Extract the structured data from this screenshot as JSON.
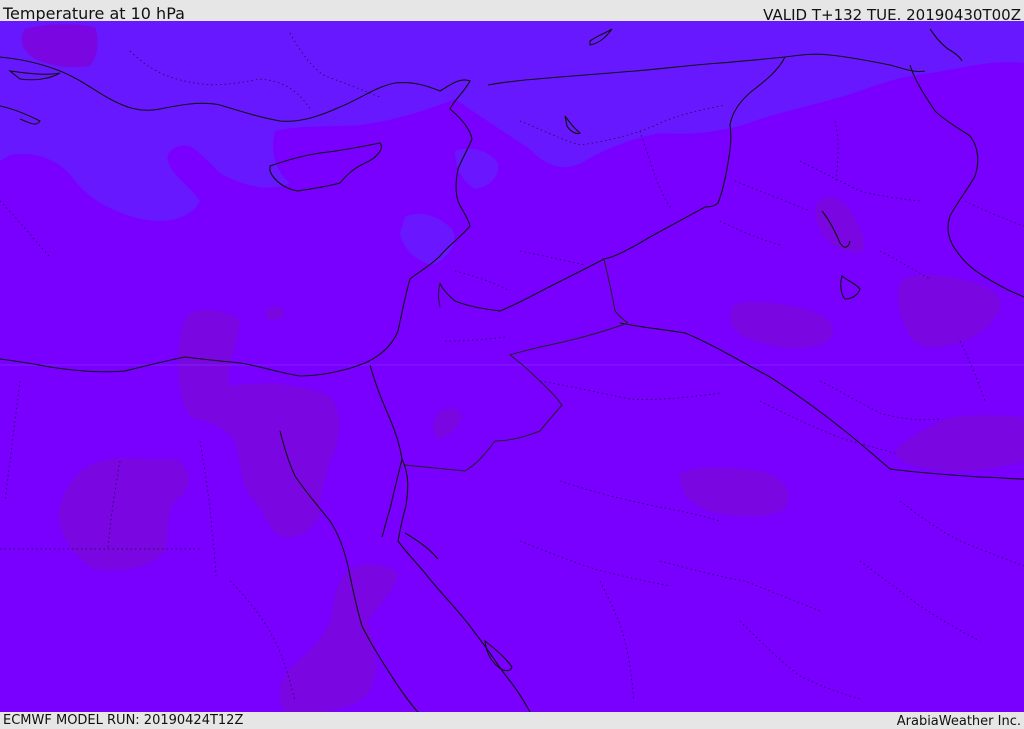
{
  "header": {
    "title": "Temperature at 10 hPa",
    "valid_time": "VALID T+132 TUE. 20190430T00Z"
  },
  "footer": {
    "model_run": "ECMWF MODEL RUN: 20190424T12Z",
    "credit": "ArabiaWeather Inc."
  },
  "map": {
    "region": "Eastern Mediterranean / Middle East",
    "colors": {
      "base_fill": "#7900ff",
      "cool_region_fill": "#6818ff",
      "warm_region_fill": "#7a08e6",
      "coastline": "#111111",
      "borders": "#222222"
    }
  }
}
